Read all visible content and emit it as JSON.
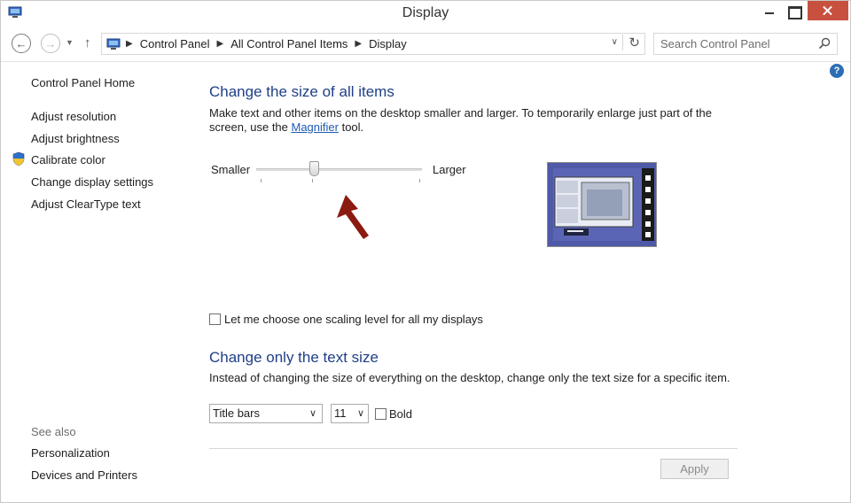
{
  "window": {
    "title": "Display"
  },
  "nav": {
    "breadcrumbs": [
      "Control Panel",
      "All Control Panel Items",
      "Display"
    ],
    "search_placeholder": "Search Control Panel"
  },
  "sidebar": {
    "items": [
      {
        "label": "Control Panel Home"
      },
      {
        "label": "Adjust resolution"
      },
      {
        "label": "Adjust brightness"
      },
      {
        "label": "Calibrate color"
      },
      {
        "label": "Change display settings"
      },
      {
        "label": "Adjust ClearType text"
      }
    ],
    "see_also_label": "See also",
    "see_also_items": [
      {
        "label": "Personalization"
      },
      {
        "label": "Devices and Printers"
      }
    ]
  },
  "scaling": {
    "heading": "Change the size of all items",
    "desc_before": "Make text and other items on the desktop smaller and larger. To temporarily enlarge just part of the screen, use the ",
    "desc_link": "Magnifier",
    "desc_after": " tool.",
    "slider_min_label": "Smaller",
    "slider_max_label": "Larger",
    "slider_level": 0.35,
    "checkbox_label": "Let me choose one scaling level for all my displays",
    "checkbox_checked": false
  },
  "text_size": {
    "heading": "Change only the text size",
    "desc": "Instead of changing the size of everything on the desktop, change only the text size for a specific item.",
    "item_select_value": "Title bars",
    "size_select_value": "11",
    "bold_label": "Bold",
    "bold_checked": false
  },
  "footer": {
    "apply_label": "Apply"
  },
  "colors": {
    "heading": "#1e3f87",
    "link": "#1e5bb5",
    "close_button": "#c7503f",
    "annotation_arrow": "#8b1a10"
  }
}
